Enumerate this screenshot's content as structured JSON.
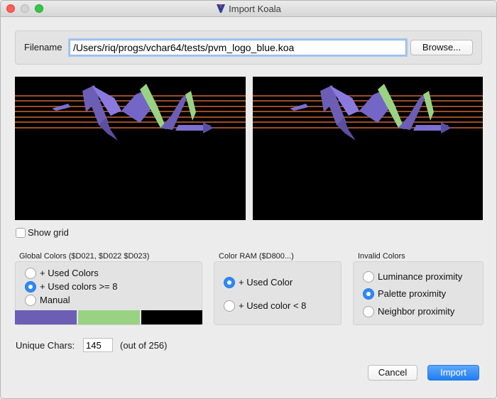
{
  "window": {
    "title": "Import Koala",
    "icon": "vchar64-app-icon"
  },
  "file": {
    "label": "Filename",
    "value": "/Users/riq/progs/vchar64/tests/pvm_logo_blue.koa",
    "browse_label": "Browse..."
  },
  "preview": {
    "left_name": "original-koala-preview",
    "right_name": "converted-charset-preview"
  },
  "show_grid": {
    "label": "Show grid",
    "checked": false
  },
  "global_colors": {
    "title": "Global Colors ($D021, $D022  $D023)",
    "options": [
      {
        "label": "+ Used Colors",
        "selected": false
      },
      {
        "label": "+ Used colors >= 8",
        "selected": true
      },
      {
        "label": "Manual",
        "selected": false
      }
    ],
    "swatches": [
      "#6c5eb5",
      "#9ad284",
      "#000000"
    ]
  },
  "color_ram": {
    "title": "Color RAM ($D800...)",
    "options": [
      {
        "label": "+ Used Color",
        "selected": true
      },
      {
        "label": "+ Used color < 8",
        "selected": false
      }
    ]
  },
  "invalid_colors": {
    "title": "Invalid Colors",
    "options": [
      {
        "label": "Luminance proximity",
        "selected": false
      },
      {
        "label": "Palette proximity",
        "selected": true
      },
      {
        "label": "Neighbor proximity",
        "selected": false
      }
    ]
  },
  "unique_chars": {
    "label": "Unique Chars:",
    "value": "145",
    "suffix": "(out of 256)"
  },
  "buttons": {
    "cancel": "Cancel",
    "import": "Import"
  },
  "colors": {
    "accent": "#2f89f5",
    "preview_bg": "#000000",
    "stripe": "#b05a2c"
  }
}
